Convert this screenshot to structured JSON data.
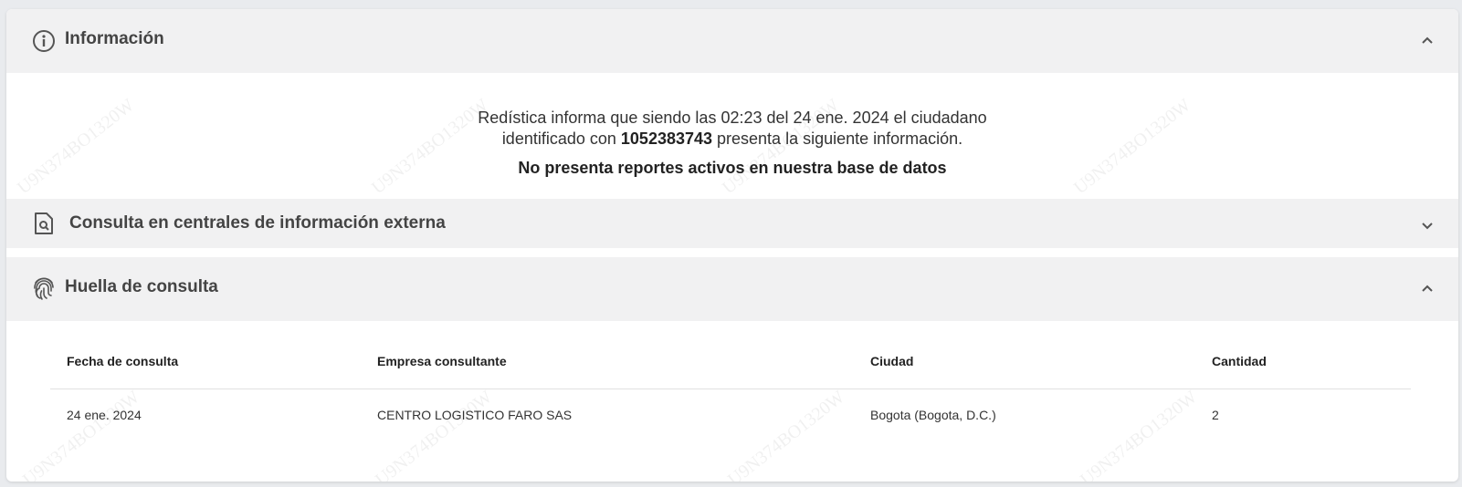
{
  "watermark": "U9N374BO1320W",
  "sections": {
    "info": {
      "title": "Información",
      "icon": "info-circle-icon",
      "expanded": true,
      "line1": "Redística informa que siendo las 02:23 del 24 ene. 2024 el ciudadano",
      "line2_prefix": "identificado con ",
      "id_number": "1052383743",
      "line2_suffix": " presenta la siguiente información.",
      "status": "No presenta reportes activos en nuestra base de datos"
    },
    "consulta": {
      "title": "Consulta en centrales de información externa",
      "icon": "document-search-icon",
      "expanded": false
    },
    "huella": {
      "title": "Huella de consulta",
      "icon": "fingerprint-icon",
      "expanded": true,
      "table": {
        "headers": [
          "Fecha de consulta",
          "Empresa consultante",
          "Ciudad",
          "Cantidad"
        ],
        "rows": [
          [
            "24 ene. 2024",
            "CENTRO LOGISTICO FARO SAS",
            "Bogota (Bogota, D.C.)",
            "2"
          ]
        ]
      }
    }
  }
}
